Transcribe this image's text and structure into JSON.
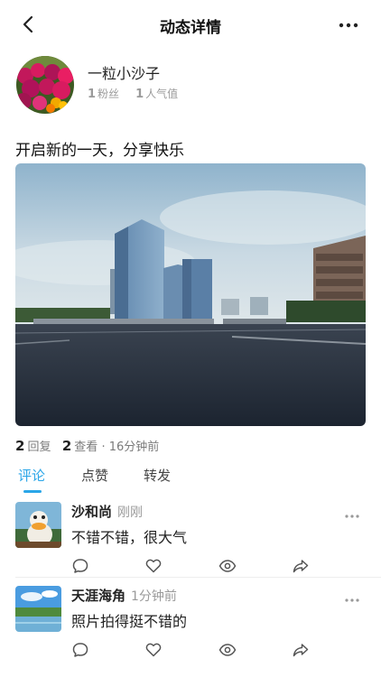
{
  "nav": {
    "title": "动态详情",
    "back_icon": "chevron-left-icon",
    "more_icon": "ellipsis-icon"
  },
  "author": {
    "name": "一粒小沙子",
    "fans_count": "1",
    "fans_label": "粉丝",
    "popularity_count": "1",
    "popularity_label": "人气值"
  },
  "post": {
    "text": "开启新的一天，分享快乐",
    "replies_count": "2",
    "replies_label": "回复",
    "views_count": "2",
    "views_label": "查看",
    "time": "· 16分钟前"
  },
  "tabs": [
    {
      "label": "评论",
      "active": true
    },
    {
      "label": "点赞",
      "active": false
    },
    {
      "label": "转发",
      "active": false
    }
  ],
  "comments": [
    {
      "name": "沙和尚",
      "time": "刚刚",
      "text": "不错不错，很大气"
    },
    {
      "name": "天涯海角",
      "time": "1分钟前",
      "text": "照片拍得挺不错的"
    }
  ],
  "colors": {
    "accent": "#2aa6e8",
    "muted": "#9a9a9a",
    "icon": "#555555"
  }
}
